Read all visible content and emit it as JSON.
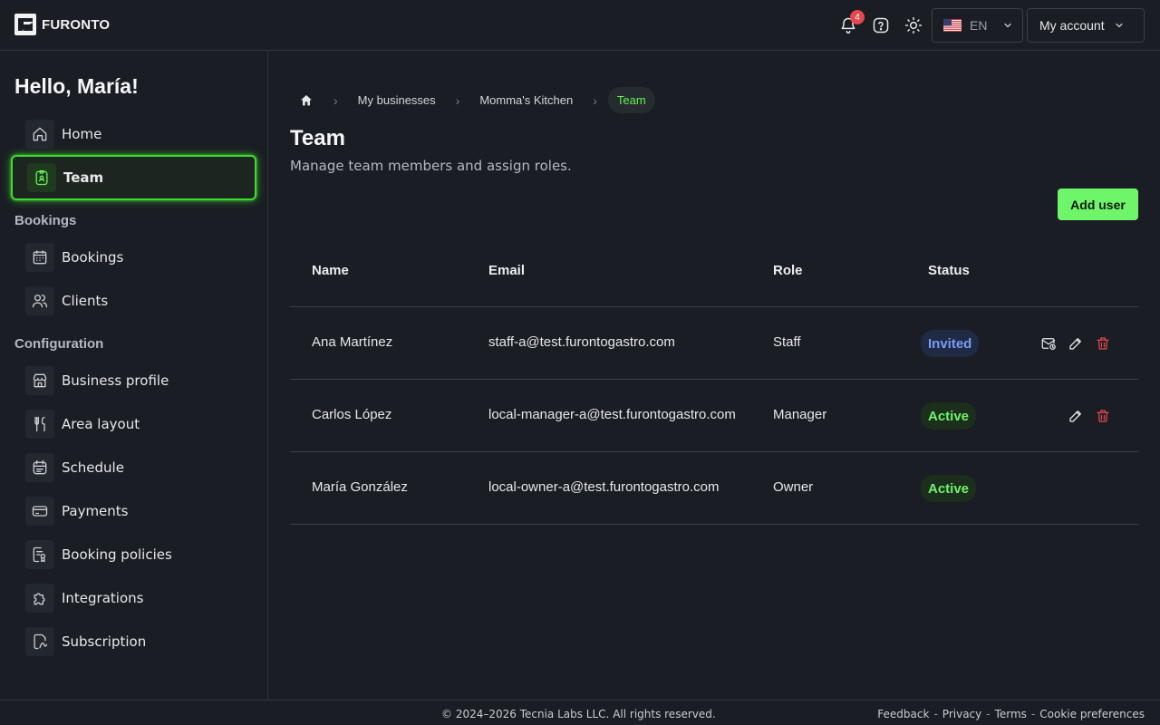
{
  "header": {
    "logo_text": "FURONTO",
    "notification_count": "4",
    "language": "EN",
    "account_label": "My account"
  },
  "sidebar": {
    "greeting": "Hello, María!",
    "items_top": [
      {
        "label": "Home",
        "icon": "home-icon"
      },
      {
        "label": "Team",
        "icon": "badge-icon",
        "active": true
      }
    ],
    "sections": [
      {
        "title": "Bookings",
        "items": [
          {
            "label": "Bookings",
            "icon": "calendar-icon"
          },
          {
            "label": "Clients",
            "icon": "users-icon"
          }
        ]
      },
      {
        "title": "Configuration",
        "items": [
          {
            "label": "Business profile",
            "icon": "store-icon"
          },
          {
            "label": "Area layout",
            "icon": "cutlery-icon"
          },
          {
            "label": "Schedule",
            "icon": "schedule-icon"
          },
          {
            "label": "Payments",
            "icon": "card-icon"
          },
          {
            "label": "Booking policies",
            "icon": "policy-icon"
          },
          {
            "label": "Integrations",
            "icon": "puzzle-icon"
          },
          {
            "label": "Subscription",
            "icon": "subscription-icon"
          }
        ]
      }
    ]
  },
  "breadcrumb": {
    "items": [
      "My businesses",
      "Momma's Kitchen",
      "Team"
    ]
  },
  "page": {
    "title": "Team",
    "subtitle": "Manage team members and assign roles.",
    "add_user_label": "Add user"
  },
  "table": {
    "columns": [
      "Name",
      "Email",
      "Role",
      "Status"
    ],
    "rows": [
      {
        "name": "Ana Martínez",
        "email": "staff-a@test.furontogastro.com",
        "role": "Staff",
        "status": "Invited"
      },
      {
        "name": "Carlos López",
        "email": "local-manager-a@test.furontogastro.com",
        "role": "Manager",
        "status": "Active"
      },
      {
        "name": "María González",
        "email": "local-owner-a@test.furontogastro.com",
        "role": "Owner",
        "status": "Active"
      }
    ]
  },
  "footer": {
    "copyright": "© 2024–2026 Tecnia Labs LLC. All rights reserved.",
    "links": [
      "Feedback",
      "Privacy",
      "Terms",
      "Cookie preferences"
    ],
    "separator": "-"
  },
  "colors": {
    "accent": "#6ef56a",
    "active_glow": "#3ddc2f",
    "invited": "#7b9cf5",
    "danger": "#e5484d",
    "background": "#1a1d23"
  }
}
